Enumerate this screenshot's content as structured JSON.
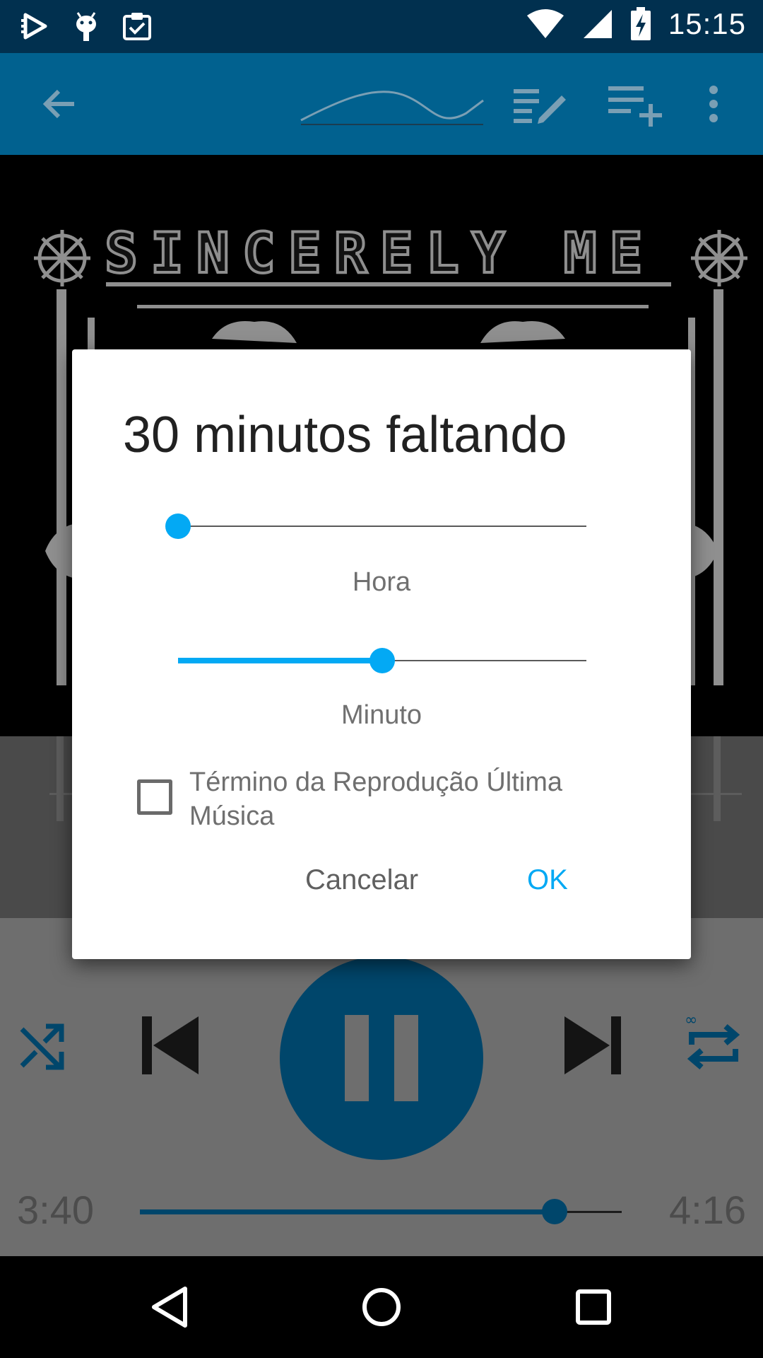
{
  "status_bar": {
    "time": "15:15",
    "icons": [
      "play-store-icon",
      "android-debug-icon",
      "clipboard-check-icon",
      "wifi-icon",
      "signal-icon",
      "battery-charging-icon"
    ]
  },
  "toolbar": {
    "icons": [
      "back-arrow-icon",
      "waveform-icon",
      "edit-list-icon",
      "playlist-add-icon",
      "more-vert-icon"
    ]
  },
  "album_art": {
    "title": "SINCERELY ME"
  },
  "player": {
    "elapsed": "3:40",
    "duration": "4:16",
    "progress": 0.86,
    "colors": {
      "accent": "#00466b"
    }
  },
  "dialog": {
    "title": "30 minutos faltando",
    "hour_slider": {
      "label": "Hora",
      "value": 0
    },
    "minute_slider": {
      "label": "Minuto",
      "value": 0.5
    },
    "checkbox_label": "Término da Reprodução Última Música",
    "checkbox_checked": false,
    "cancel_label": "Cancelar",
    "ok_label": "OK",
    "colors": {
      "accent": "#03a9f4"
    }
  },
  "nav_bar": {
    "icons": [
      "back-triangle-icon",
      "home-circle-icon",
      "recents-square-icon"
    ]
  }
}
